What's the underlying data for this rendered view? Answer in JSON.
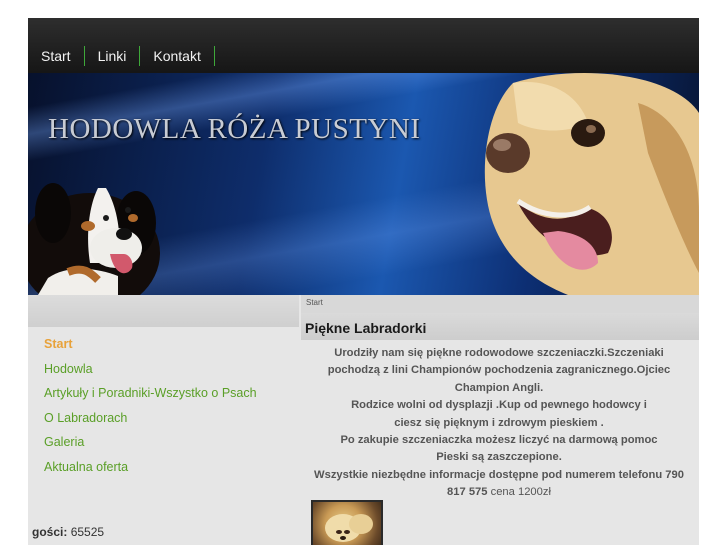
{
  "nav": {
    "items": [
      "Start",
      "Linki",
      "Kontakt"
    ]
  },
  "banner": {
    "title": "HODOWLA RÓŻA PUSTYNI"
  },
  "sidebar": {
    "items": [
      {
        "label": "Start",
        "active": true
      },
      {
        "label": "Hodowla",
        "active": false
      },
      {
        "label": "Artykuły i Poradniki-Wszystko o Psach",
        "active": false
      },
      {
        "label": "O Labradorach",
        "active": false
      },
      {
        "label": "Galeria",
        "active": false
      },
      {
        "label": "Aktualna oferta",
        "active": false
      }
    ],
    "visits_label": "gości:",
    "visits_count": "65525"
  },
  "main": {
    "breadcrumb": "Start",
    "title": "Piękne Labradorki",
    "lines": [
      "Urodziły nam się piękne rodowodowe szczeniaczki.Szczeniaki",
      "pochodzą z lini Championów pochodzenia zagranicznego.Ojciec",
      "Champion Angli.",
      "Rodzice wolni od dysplazji .Kup od pewnego hodowcy i",
      "ciesz się pięknym i zdrowym pieskiem .",
      "Po zakupie szczeniaczka możesz liczyć na darmową pomoc",
      "Pieski są zaszczepione.",
      "Wszystkie niezbędne informacje dostępne pod numerem telefonu 790"
    ],
    "phone_end": "817 575",
    "price": "cena 1200zł"
  },
  "colors": {
    "nav_bg": "#232323",
    "separator": "#3fa83a",
    "link": "#5a9f27",
    "active_link": "#e8a23a",
    "content_bg": "#e6e6e6"
  }
}
